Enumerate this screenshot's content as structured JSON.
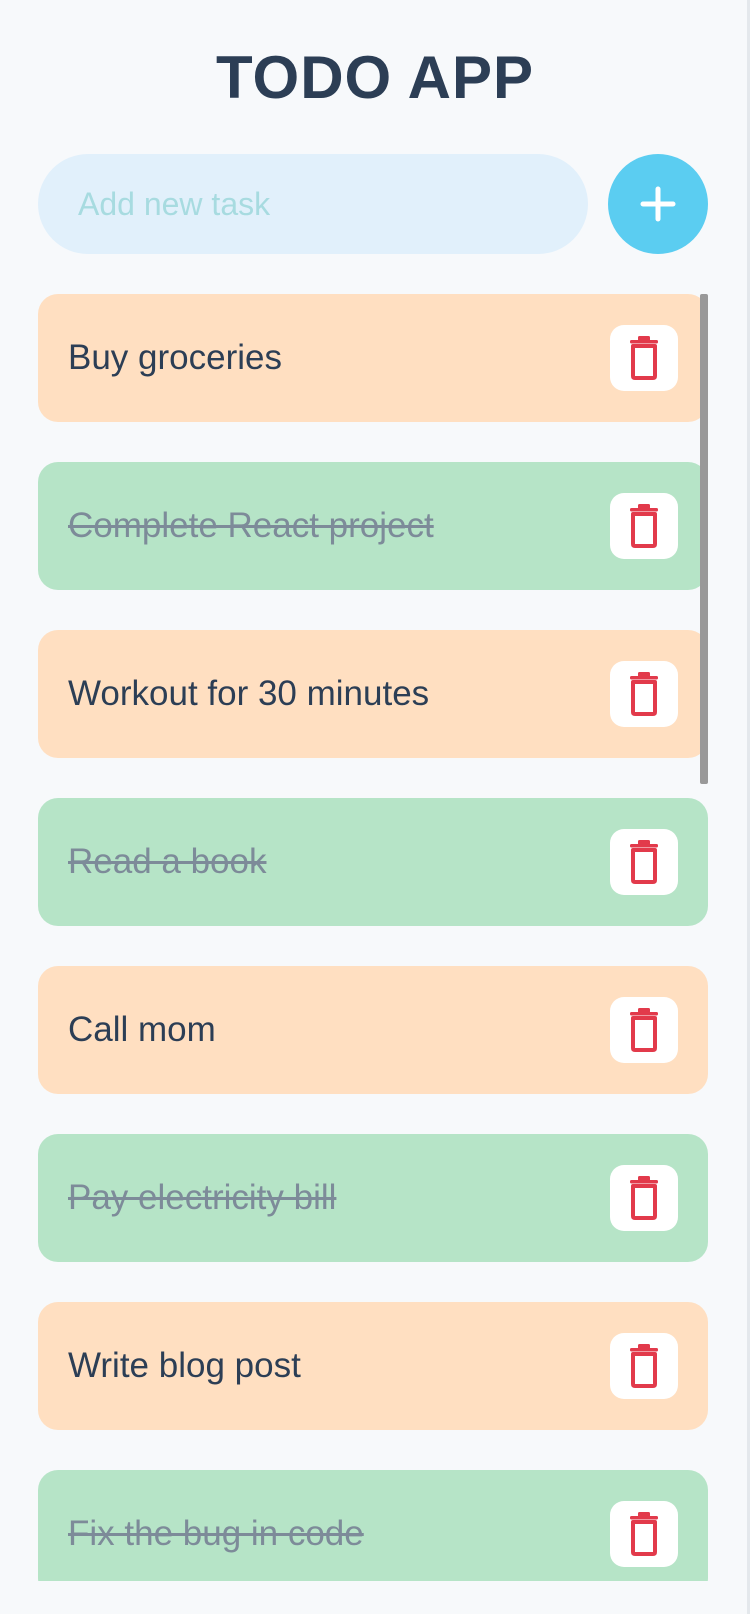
{
  "app": {
    "title": "TODO APP"
  },
  "new_task": {
    "value": "",
    "placeholder": "Add new task",
    "add_icon": "plus-icon"
  },
  "colors": {
    "pending": "#ffdfc1",
    "done": "#b6e4c7",
    "accent": "#5bcdf1",
    "delete": "#e23a4b"
  },
  "tasks": [
    {
      "text": "Buy groceries",
      "completed": false
    },
    {
      "text": "Complete React project",
      "completed": true
    },
    {
      "text": "Workout for 30 minutes",
      "completed": false
    },
    {
      "text": "Read a book",
      "completed": true
    },
    {
      "text": "Call mom",
      "completed": false
    },
    {
      "text": "Pay electricity bill",
      "completed": true
    },
    {
      "text": "Write blog post",
      "completed": false
    },
    {
      "text": "Fix the bug in code",
      "completed": true
    }
  ],
  "delete_icon": "trash-icon"
}
